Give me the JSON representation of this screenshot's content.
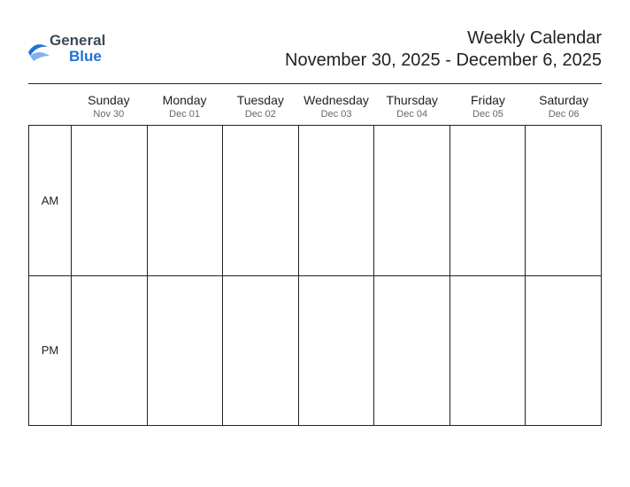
{
  "logo": {
    "top": "General",
    "bottom": "Blue"
  },
  "title": "Weekly Calendar",
  "date_range": "November 30, 2025 - December 6, 2025",
  "days": [
    {
      "name": "Sunday",
      "date": "Nov 30"
    },
    {
      "name": "Monday",
      "date": "Dec 01"
    },
    {
      "name": "Tuesday",
      "date": "Dec 02"
    },
    {
      "name": "Wednesday",
      "date": "Dec 03"
    },
    {
      "name": "Thursday",
      "date": "Dec 04"
    },
    {
      "name": "Friday",
      "date": "Dec 05"
    },
    {
      "name": "Saturday",
      "date": "Dec 06"
    }
  ],
  "periods": [
    "AM",
    "PM"
  ]
}
